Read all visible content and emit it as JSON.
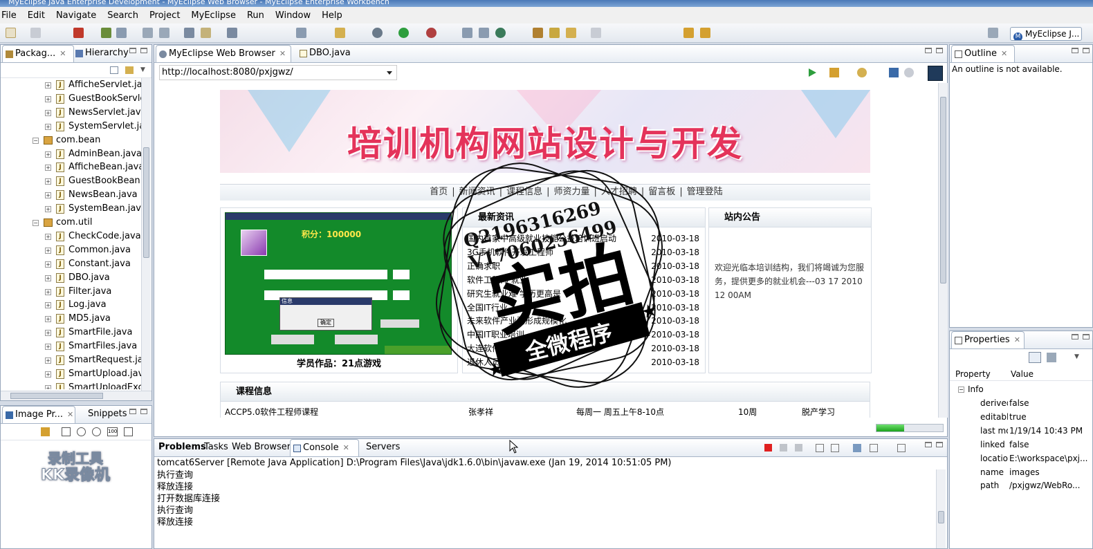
{
  "window": {
    "title": "MyEclipse Java Enterprise Development - MyEclipse Web Browser - MyEclipse Enterprise Workbench"
  },
  "menu": [
    "File",
    "Edit",
    "Navigate",
    "Search",
    "Project",
    "MyEclipse",
    "Run",
    "Window",
    "Help"
  ],
  "perspective": {
    "label": "MyEclipse J..."
  },
  "package_explorer": {
    "tabs": [
      "Packag...",
      "Hierarchy"
    ],
    "items": [
      {
        "label": "AfficheServlet.java",
        "kind": "java"
      },
      {
        "label": "GuestBookServlet",
        "kind": "java"
      },
      {
        "label": "NewsServlet.java",
        "kind": "java"
      },
      {
        "label": "SystemServlet.java",
        "kind": "java"
      },
      {
        "label": "com.bean",
        "kind": "package"
      },
      {
        "label": "AdminBean.java",
        "kind": "java"
      },
      {
        "label": "AfficheBean.java",
        "kind": "java"
      },
      {
        "label": "GuestBookBean.ja",
        "kind": "java"
      },
      {
        "label": "NewsBean.java",
        "kind": "java"
      },
      {
        "label": "SystemBean.java",
        "kind": "java"
      },
      {
        "label": "com.util",
        "kind": "package"
      },
      {
        "label": "CheckCode.java",
        "kind": "java"
      },
      {
        "label": "Common.java",
        "kind": "java"
      },
      {
        "label": "Constant.java",
        "kind": "java"
      },
      {
        "label": "DBO.java",
        "kind": "java"
      },
      {
        "label": "Filter.java",
        "kind": "java"
      },
      {
        "label": "Log.java",
        "kind": "java"
      },
      {
        "label": "MD5.java",
        "kind": "java"
      },
      {
        "label": "SmartFile.java",
        "kind": "java"
      },
      {
        "label": "SmartFiles.java",
        "kind": "java"
      },
      {
        "label": "SmartRequest.java",
        "kind": "java"
      },
      {
        "label": "SmartUpload.java",
        "kind": "java"
      },
      {
        "label": "SmartUploadExce",
        "kind": "java"
      }
    ]
  },
  "image_panel": {
    "tabs": [
      "Image Pr...",
      "Snippets"
    ],
    "watermark_line1": "录制工具",
    "watermark_line2": "KK录像机"
  },
  "editor": {
    "tabs": [
      "MyEclipse Web Browser",
      "DBO.java"
    ],
    "url": "http://localhost:8080/pxjgwz/"
  },
  "website": {
    "banner_title": "培训机构网站设计与开发",
    "nav": [
      "首页",
      "新闻资讯",
      "课程信息",
      "师资力量",
      "人才招聘",
      "留言板",
      "管理登陆"
    ],
    "nav_separator": "|",
    "student_work_caption": "学员作品：21点游戏",
    "news_head": "最新资讯",
    "news": [
      {
        "title": "国内首家中高级就业技能公益培训班启动",
        "date": "2010-03-18"
      },
      {
        "title": "3G手机软件开发工程师",
        "date": "2010-03-18"
      },
      {
        "title": "正确求职",
        "date": "2010-03-18"
      },
      {
        "title": "软件工程师 就业",
        "date": "2010-03-18"
      },
      {
        "title": "研究生就业难 学历更高是",
        "date": "2010-03-18"
      },
      {
        "title": "全国IT行业",
        "date": "2010-03-18"
      },
      {
        "title": "未来软件产业要形成规模化",
        "date": "2010-03-18"
      },
      {
        "title": "中国IT职业培训",
        "date": "2010-03-18"
      },
      {
        "title": "大连软件",
        "date": "2010-03-18"
      },
      {
        "title": "退休人员",
        "date": "2010-03-18"
      }
    ],
    "notice_head": "站内公告",
    "notice_text": "欢迎光临本培训结构，我们将竭诚为您服务，提供更多的就业机会---03 17 2010 12 00AM",
    "courses_head": "课程信息",
    "course_row": [
      "ACCP5.0软件工程师课程",
      "张孝祥",
      "每周一 周五上午8-10点",
      "10周",
      "脱产学习"
    ],
    "game": {
      "score_label": "积分：",
      "score": "100000",
      "dialog_title": "信息",
      "ok": "确定"
    }
  },
  "stamp": {
    "qq": "Q2196316269",
    "wx": "V17060256499",
    "main": "实拍",
    "ribbon": "全微程序"
  },
  "outline": {
    "tab": "Outline",
    "message": "An outline is not available."
  },
  "console": {
    "tabs": [
      "Problems",
      "Tasks",
      "Web Browser",
      "Console",
      "Servers"
    ],
    "header": "tomcat6Server [Remote Java Application] D:\\Program Files\\Java\\jdk1.6.0\\bin\\javaw.exe (Jan 19, 2014 10:51:05 PM)",
    "lines": [
      "执行查询",
      "释放连接",
      "打开数据库连接",
      "执行查询",
      "释放连接"
    ]
  },
  "properties": {
    "tab": "Properties",
    "columns": [
      "Property",
      "Value"
    ],
    "category": "Info",
    "rows": [
      {
        "k": "derived",
        "v": "false"
      },
      {
        "k": "editable",
        "v": "true"
      },
      {
        "k": "last modified",
        "v": "1/19/14 10:43 PM"
      },
      {
        "k": "linked",
        "v": "false"
      },
      {
        "k": "location",
        "v": "E:\\workspace\\pxj..."
      },
      {
        "k": "name",
        "v": "images"
      },
      {
        "k": "path",
        "v": "/pxjgwz/WebRo..."
      }
    ]
  },
  "progress": 0.42
}
